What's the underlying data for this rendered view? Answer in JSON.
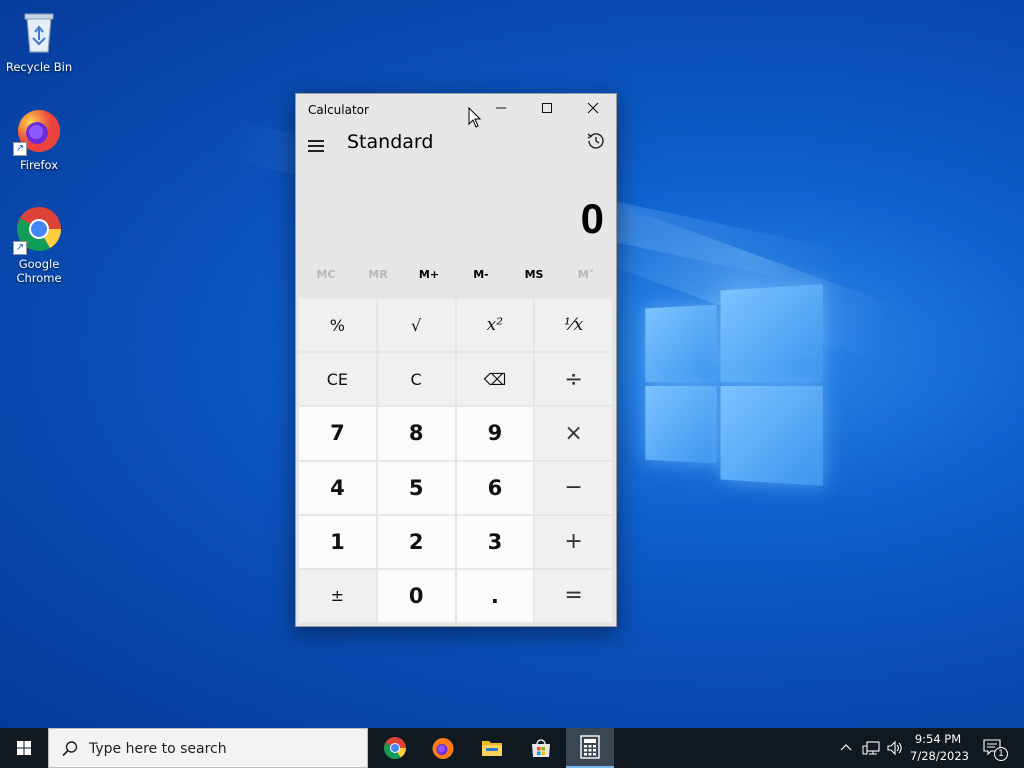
{
  "desktop": {
    "icons": [
      {
        "label": "Recycle Bin",
        "icon": "recycle-bin-icon"
      },
      {
        "label": "Firefox",
        "icon": "firefox-icon"
      },
      {
        "label": "Google Chrome",
        "icon": "chrome-icon"
      }
    ]
  },
  "calculator": {
    "window_title": "Calculator",
    "caption_buttons": {
      "minimize": "–",
      "maximize": "☐",
      "close": "✕"
    },
    "mode": "Standard",
    "display_value": "0",
    "memory": [
      {
        "label": "MC",
        "enabled": false
      },
      {
        "label": "MR",
        "enabled": false
      },
      {
        "label": "M+",
        "enabled": true
      },
      {
        "label": "M-",
        "enabled": true
      },
      {
        "label": "MS",
        "enabled": true
      },
      {
        "label": "M˅",
        "enabled": false
      }
    ],
    "keys": [
      {
        "label": "%",
        "name": "percent-key",
        "kind": "func"
      },
      {
        "label": "√",
        "name": "square-root-key",
        "kind": "func"
      },
      {
        "label": "x²",
        "name": "square-key",
        "kind": "func"
      },
      {
        "label": "¹⁄x",
        "name": "reciprocal-key",
        "kind": "func"
      },
      {
        "label": "CE",
        "name": "clear-entry-key",
        "kind": "func"
      },
      {
        "label": "C",
        "name": "clear-key",
        "kind": "func"
      },
      {
        "label": "⌫",
        "name": "backspace-key",
        "kind": "func"
      },
      {
        "label": "÷",
        "name": "divide-key",
        "kind": "op"
      },
      {
        "label": "7",
        "name": "digit-7-key",
        "kind": "digit"
      },
      {
        "label": "8",
        "name": "digit-8-key",
        "kind": "digit"
      },
      {
        "label": "9",
        "name": "digit-9-key",
        "kind": "digit"
      },
      {
        "label": "×",
        "name": "multiply-key",
        "kind": "op"
      },
      {
        "label": "4",
        "name": "digit-4-key",
        "kind": "digit"
      },
      {
        "label": "5",
        "name": "digit-5-key",
        "kind": "digit"
      },
      {
        "label": "6",
        "name": "digit-6-key",
        "kind": "digit"
      },
      {
        "label": "−",
        "name": "subtract-key",
        "kind": "op"
      },
      {
        "label": "1",
        "name": "digit-1-key",
        "kind": "digit"
      },
      {
        "label": "2",
        "name": "digit-2-key",
        "kind": "digit"
      },
      {
        "label": "3",
        "name": "digit-3-key",
        "kind": "digit"
      },
      {
        "label": "+",
        "name": "add-key",
        "kind": "op"
      },
      {
        "label": "±",
        "name": "negate-key",
        "kind": "func"
      },
      {
        "label": "0",
        "name": "digit-0-key",
        "kind": "digit"
      },
      {
        "label": ".",
        "name": "decimal-key",
        "kind": "digit"
      },
      {
        "label": "=",
        "name": "equals-key",
        "kind": "op"
      }
    ]
  },
  "taskbar": {
    "search_placeholder": "Type here to search",
    "apps": [
      {
        "name": "chrome-icon",
        "active": false
      },
      {
        "name": "firefox-icon",
        "active": false
      },
      {
        "name": "file-explorer-icon",
        "active": false
      },
      {
        "name": "microsoft-store-icon",
        "active": false
      },
      {
        "name": "calculator-icon",
        "active": true
      }
    ],
    "tray": {
      "time": "9:54 PM",
      "date": "7/28/2023",
      "notification_count": "1"
    }
  },
  "colors": {
    "accent": "#76b9ed",
    "taskbar": "#101820",
    "calc_bg": "#e6e6e6"
  }
}
